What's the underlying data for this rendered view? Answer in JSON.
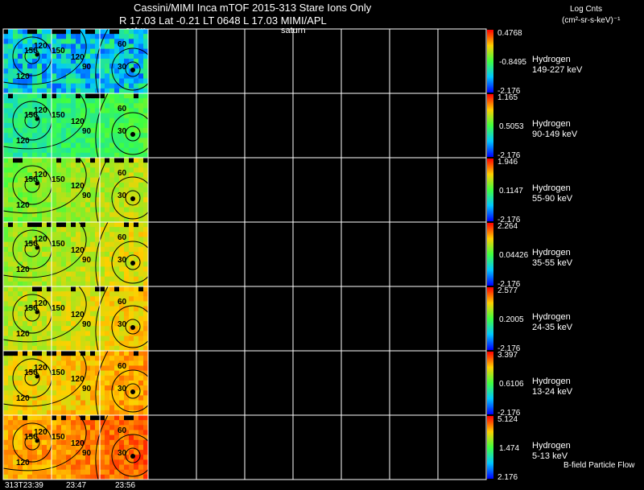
{
  "header": {
    "title_line1": "Cassini/MIMI Inca mTOF  2015-313   Stare   Ions Only",
    "title_line2": "R        17.03 Lat -0.21 LT 0648 L           17.03  MIMI/APL",
    "saturn_label_1": "satur",
    "saturn_label_2": "saturn",
    "units_line1": "Log Cnts",
    "units_line2": "(cm²-sr-s-keV)⁻¹"
  },
  "footer": {
    "bfield_label": "B-field Particle Flow",
    "time_ticks": [
      "313T23:39",
      "23:47",
      "23:56"
    ]
  },
  "chart_data": {
    "type": "heatmap",
    "title": "Cassini/MIMI Inca mTOF  2015-313   Stare   Ions Only",
    "x_ticks": [
      "313T23:39",
      "23:47",
      "23:56"
    ],
    "colorbar_label": "Log Cnts (cm²-sr-s-keV)⁻¹",
    "contour_levels_left": [
      "150",
      "120",
      "150",
      "120",
      "90"
    ],
    "contour_levels_right": [
      "90",
      "60",
      "30"
    ],
    "panels": [
      {
        "species": "Hydrogen",
        "energy": "149-227 keV",
        "cb_max": "0.4768",
        "cb_mid": "-0.8495",
        "cb_min": "-2.176",
        "level": 0.28
      },
      {
        "species": "Hydrogen",
        "energy": "90-149 keV",
        "cb_max": "1.165",
        "cb_mid": "0.5053",
        "cb_min": "-2.176",
        "level": 0.45
      },
      {
        "species": "Hydrogen",
        "energy": "55-90 keV",
        "cb_max": "1.946",
        "cb_mid": "0.1147",
        "cb_min": "-2.176",
        "level": 0.62
      },
      {
        "species": "Hydrogen",
        "energy": "35-55 keV",
        "cb_max": "2.264",
        "cb_mid": "0.04426",
        "cb_min": "-2.176",
        "level": 0.66
      },
      {
        "species": "Hydrogen",
        "energy": "24-35 keV",
        "cb_max": "2.577",
        "cb_mid": "0.2005",
        "cb_min": "-2.176",
        "level": 0.7
      },
      {
        "species": "Hydrogen",
        "energy": "13-24 keV",
        "cb_max": "3.397",
        "cb_mid": "0.6106",
        "cb_min": "-2.176",
        "level": 0.76
      },
      {
        "species": "Hydrogen",
        "energy": "5-13 keV",
        "cb_max": "5.124",
        "cb_mid": "1.474",
        "cb_min": "2.176",
        "level": 0.84
      }
    ]
  }
}
